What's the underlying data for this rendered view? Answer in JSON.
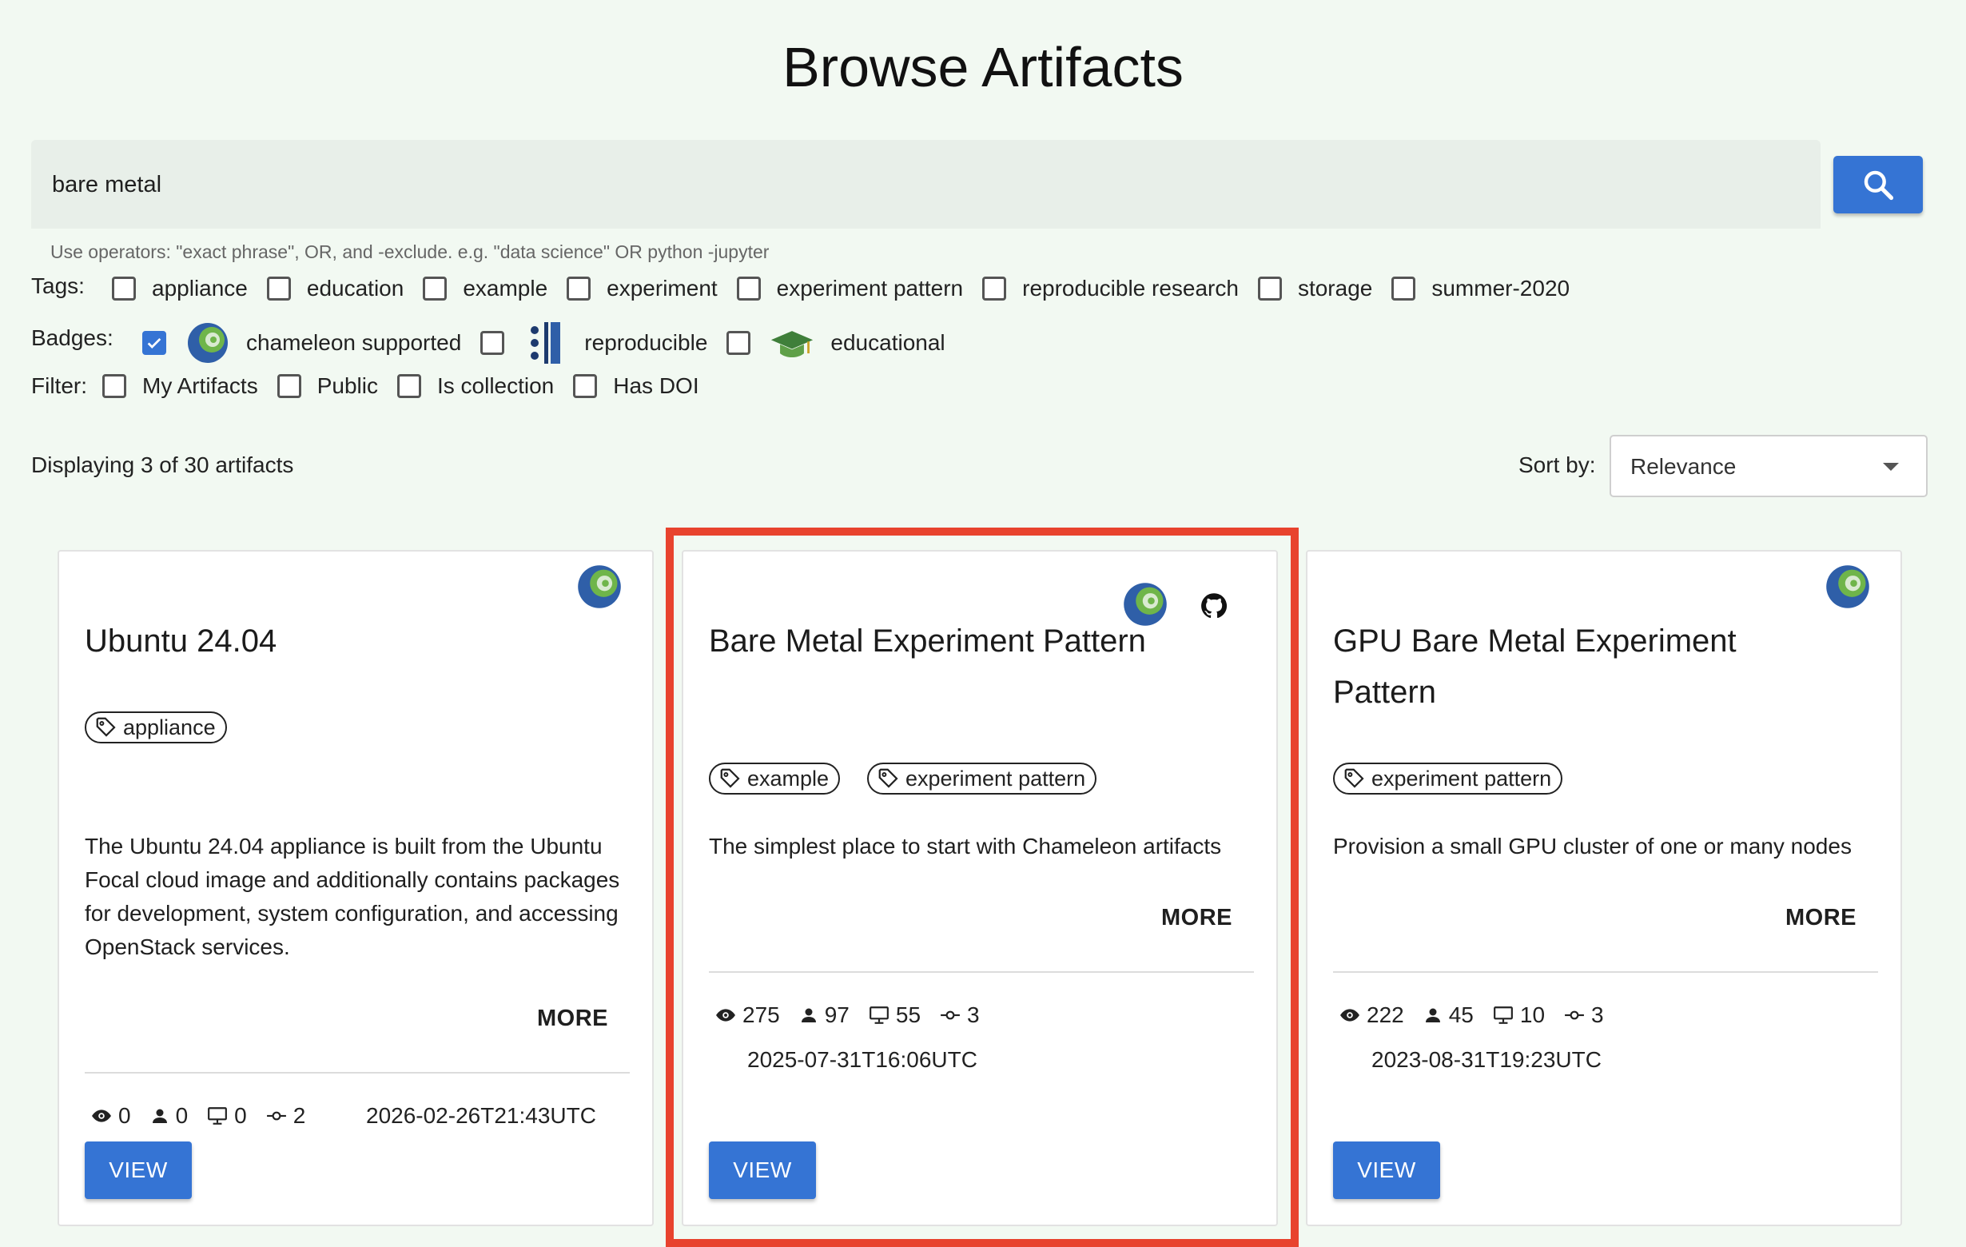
{
  "page": {
    "title": "Browse Artifacts"
  },
  "search": {
    "value": "bare metal",
    "hint": "Use operators: \"exact phrase\", OR, and -exclude. e.g. \"data science\" OR python -jupyter"
  },
  "tags": {
    "label": "Tags:",
    "items": [
      {
        "label": "appliance",
        "checked": false
      },
      {
        "label": "education",
        "checked": false
      },
      {
        "label": "example",
        "checked": false
      },
      {
        "label": "experiment",
        "checked": false
      },
      {
        "label": "experiment pattern",
        "checked": false
      },
      {
        "label": "reproducible research",
        "checked": false
      },
      {
        "label": "storage",
        "checked": false
      },
      {
        "label": "summer-2020",
        "checked": false
      }
    ]
  },
  "badges": {
    "label": "Badges:",
    "items": [
      {
        "label": "chameleon supported",
        "checked": true,
        "icon": "chameleon-icon"
      },
      {
        "label": "reproducible",
        "checked": false,
        "icon": "reproducible-icon"
      },
      {
        "label": "educational",
        "checked": false,
        "icon": "graduation-cap-icon"
      }
    ]
  },
  "filter": {
    "label": "Filter:",
    "items": [
      {
        "label": "My Artifacts",
        "checked": false
      },
      {
        "label": "Public",
        "checked": false
      },
      {
        "label": "Is collection",
        "checked": false
      },
      {
        "label": "Has DOI",
        "checked": false
      }
    ]
  },
  "results": {
    "count_text": "Displaying 3 of 30 artifacts"
  },
  "sort": {
    "label": "Sort by:",
    "value": "Relevance"
  },
  "colors": {
    "accent": "#3574d4",
    "highlight": "#e8432e",
    "background": "#f2f9f2"
  },
  "cards": [
    {
      "title": "Ubuntu 24.04",
      "tags": [
        "appliance"
      ],
      "description": "The Ubuntu 24.04 appliance is built from the Ubuntu Focal cloud image and additionally contains packages for development, system configuration, and accessing OpenStack services.",
      "more": "MORE",
      "stats": {
        "views": "0",
        "users": "0",
        "launches": "0",
        "versions": "2"
      },
      "date": "2026-02-26T21:43UTC",
      "view": "VIEW",
      "badges": [
        "chameleon-icon"
      ]
    },
    {
      "title": "Bare Metal Experiment Pattern",
      "tags": [
        "example",
        "experiment pattern"
      ],
      "description": "The simplest place to start with Chameleon artifacts",
      "more": "MORE",
      "stats": {
        "views": "275",
        "users": "97",
        "launches": "55",
        "versions": "3"
      },
      "date": "2025-07-31T16:06UTC",
      "view": "VIEW",
      "badges": [
        "chameleon-icon",
        "github-icon"
      ]
    },
    {
      "title": "GPU Bare Metal Experiment Pattern",
      "tags": [
        "experiment pattern"
      ],
      "description": "Provision a small GPU cluster of one or many nodes",
      "more": "MORE",
      "stats": {
        "views": "222",
        "users": "45",
        "launches": "10",
        "versions": "3"
      },
      "date": "2023-08-31T19:23UTC",
      "view": "VIEW",
      "badges": [
        "chameleon-icon"
      ]
    }
  ]
}
